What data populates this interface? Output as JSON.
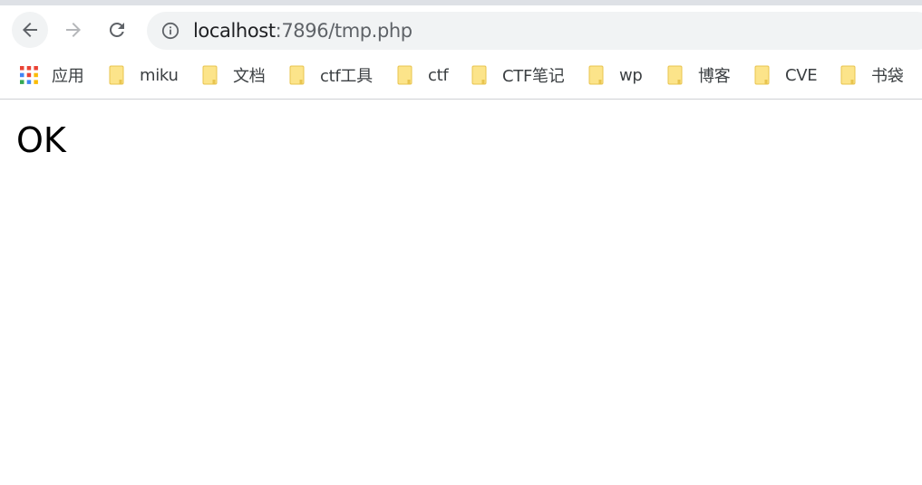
{
  "toolbar": {
    "back_icon": "arrow-left-icon",
    "forward_icon": "arrow-right-icon",
    "reload_icon": "reload-icon"
  },
  "omnibox": {
    "info_icon": "info-icon",
    "host": "localhost",
    "rest": ":7896/tmp.php"
  },
  "bookmarks": {
    "apps_label": "应用",
    "items": [
      {
        "label": "miku",
        "icon": "folder-icon"
      },
      {
        "label": "文档",
        "icon": "folder-icon"
      },
      {
        "label": "ctf工具",
        "icon": "folder-icon"
      },
      {
        "label": "ctf",
        "icon": "folder-icon"
      },
      {
        "label": "CTF笔记",
        "icon": "folder-icon"
      },
      {
        "label": "wp",
        "icon": "folder-icon"
      },
      {
        "label": "博客",
        "icon": "folder-icon"
      },
      {
        "label": "CVE",
        "icon": "folder-icon"
      },
      {
        "label": "书袋",
        "icon": "folder-icon"
      }
    ]
  },
  "page": {
    "text": "OK"
  },
  "colors": {
    "folder_fill": "#fce48a",
    "folder_stroke": "#e8c44e",
    "apps_red": "#ea4335",
    "apps_blue": "#4285f4",
    "apps_yellow": "#fbbc05",
    "apps_green": "#34a853"
  }
}
